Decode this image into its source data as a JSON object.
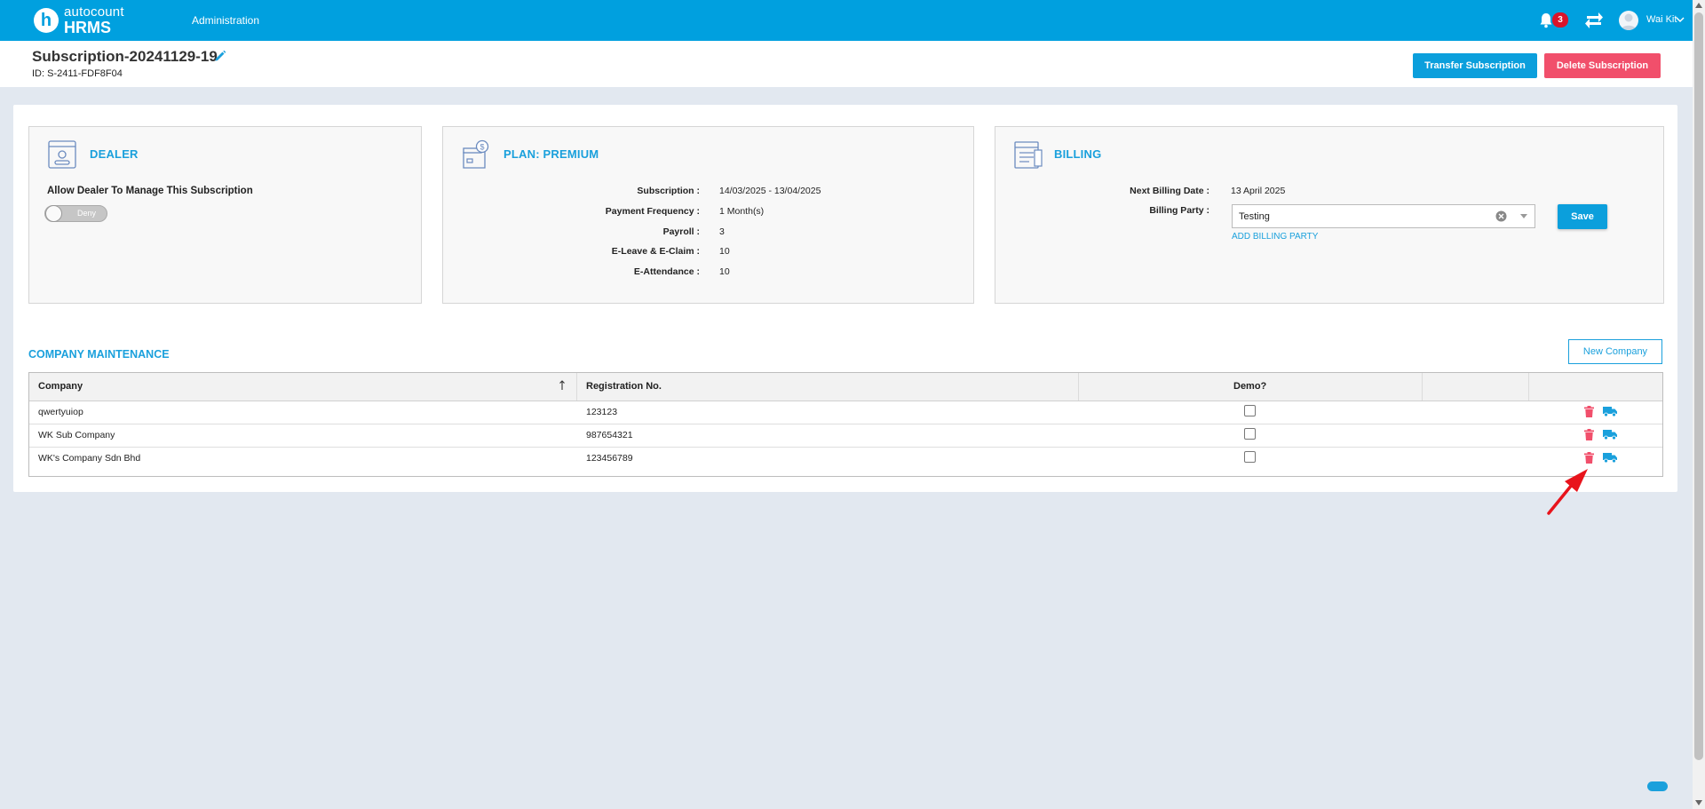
{
  "brand": {
    "line1": "autocount",
    "line2": "HRMS",
    "logo_letter": "h",
    "color": "#00a0df"
  },
  "nav": {
    "administration": "Administration"
  },
  "notifications": {
    "count": "3"
  },
  "user": {
    "name": "Wai Kit"
  },
  "header": {
    "title": "Subscription-20241129-19",
    "id_line": "ID: S-2411-FDF8F04",
    "transfer_label": "Transfer Subscription",
    "delete_label": "Delete Subscription"
  },
  "dealer": {
    "title": "DEALER",
    "allow_label": "Allow Dealer To Manage This Subscription",
    "toggle_label": "Deny",
    "toggle_on": false
  },
  "plan": {
    "title": "PLAN: PREMIUM",
    "rows": [
      {
        "label": "Subscription :",
        "value": "14/03/2025 - 13/04/2025"
      },
      {
        "label": "Payment Frequency :",
        "value": "1 Month(s)"
      },
      {
        "label": "Payroll :",
        "value": "3"
      },
      {
        "label": "E-Leave & E-Claim :",
        "value": "10"
      },
      {
        "label": "E-Attendance :",
        "value": "10"
      }
    ]
  },
  "billing": {
    "title": "BILLING",
    "next_date_label": "Next Billing Date :",
    "next_date_value": "13 April 2025",
    "party_label": "Billing Party :",
    "party_value": "Testing",
    "add_party_label": "ADD BILLING PARTY",
    "save_label": "Save"
  },
  "companies": {
    "title": "COMPANY MAINTENANCE",
    "new_label": "New Company",
    "columns": {
      "company": "Company",
      "registration": "Registration No.",
      "demo": "Demo?"
    },
    "rows": [
      {
        "company": "qwertyuiop",
        "registration": "123123",
        "demo": false
      },
      {
        "company": "WK Sub Company",
        "registration": "987654321",
        "demo": false
      },
      {
        "company": "WK's Company Sdn Bhd",
        "registration": "123456789",
        "demo": false
      }
    ]
  },
  "colors": {
    "primary": "#0b9fdc",
    "danger": "#f14f6b",
    "badge": "#d9142a",
    "annotation": "#e8141c"
  }
}
